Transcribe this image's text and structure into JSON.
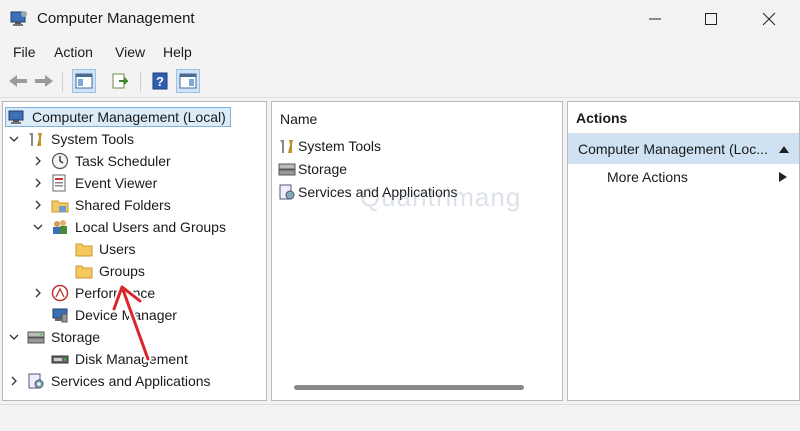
{
  "window": {
    "title": "Computer Management"
  },
  "menu": [
    {
      "label": "File"
    },
    {
      "label": "Action"
    },
    {
      "label": "View"
    },
    {
      "label": "Help"
    }
  ],
  "tree": {
    "root": "Computer Management (Local)",
    "system_tools": "System Tools",
    "task_scheduler": "Task Scheduler",
    "event_viewer": "Event Viewer",
    "shared_folders": "Shared Folders",
    "local_users_groups": "Local Users and Groups",
    "users": "Users",
    "groups": "Groups",
    "performance": "Performance",
    "device_manager": "Device Manager",
    "storage": "Storage",
    "disk_management": "Disk Management",
    "services_apps": "Services and Applications"
  },
  "middle": {
    "column_header": "Name",
    "rows": [
      {
        "label": "System Tools"
      },
      {
        "label": "Storage"
      },
      {
        "label": "Services and Applications"
      }
    ]
  },
  "actions": {
    "header": "Actions",
    "selected": "Computer Management (Loc...",
    "more": "More Actions"
  },
  "watermark": "Quantrimang",
  "colors": {
    "selection": "#dcebf8",
    "arrow": "#d9262b",
    "folder": "#f4c95d"
  }
}
